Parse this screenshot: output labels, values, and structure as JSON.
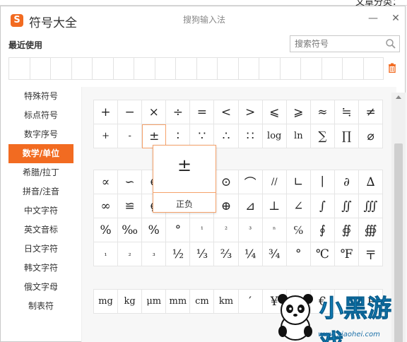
{
  "background": {
    "corner_text": "文章分类："
  },
  "titlebar": {
    "logo_glyph": "S",
    "app_title": "符号大全",
    "ime_title": "搜狗输入法",
    "minimize_glyph": "—",
    "close_glyph": "✕"
  },
  "recent": {
    "label": "最近使用",
    "cells": 18
  },
  "search": {
    "placeholder": "搜索符号"
  },
  "sidebar": {
    "items": [
      {
        "label": "特殊符号"
      },
      {
        "label": "标点符号"
      },
      {
        "label": "数字序号"
      },
      {
        "label": "数学/单位",
        "active": true
      },
      {
        "label": "希腊/拉丁"
      },
      {
        "label": "拼音/注音"
      },
      {
        "label": "中文字符"
      },
      {
        "label": "英文音标"
      },
      {
        "label": "日文字符"
      },
      {
        "label": "韩文字符"
      },
      {
        "label": "俄文字母"
      },
      {
        "label": "制表符"
      }
    ]
  },
  "groups": [
    {
      "rows": [
        [
          "+",
          "−",
          "×",
          "÷",
          "=",
          "<",
          ">",
          "⩽",
          "⩾",
          "≈",
          "≒",
          "≠"
        ],
        [
          "+",
          "-",
          "±",
          "∶",
          "∵",
          "∴",
          "∷",
          "log",
          "ln",
          "∑",
          "∏",
          "⌀"
        ]
      ]
    },
    {
      "rows": [
        [
          "∝",
          "∽",
          "∈",
          "",
          "",
          "⊙",
          "⌒",
          "//",
          "∟",
          "∣",
          "∂",
          "∆"
        ],
        [
          "∞",
          "≌",
          "∉",
          "",
          "",
          "⊕",
          "⊿",
          "⊥",
          "∠",
          "∫",
          "∬",
          "∭"
        ],
        [
          "%",
          "‰",
          "%",
          "°",
          "¹",
          "²",
          "³",
          "ⁿ",
          "℅",
          "∮",
          "∯",
          "∰"
        ],
        [
          "₁",
          "₂",
          "₃",
          "½",
          "⅓",
          "⅔",
          "¼",
          "¾",
          "°",
          "℃",
          "℉",
          "〒"
        ]
      ]
    },
    {
      "rows": [
        [
          "mg",
          "kg",
          "μm",
          "mm",
          "cm",
          "km",
          "′",
          "¥",
          "",
          "€",
          "",
          "₣"
        ]
      ]
    }
  ],
  "popup": {
    "symbol": "±",
    "name": "正负"
  },
  "watermark": {
    "text": "小黑游戏",
    "url": "www.xiaohei.com"
  },
  "colors": {
    "accent": "#f26b21",
    "cell_border": "#e5e5e5",
    "popup_border": "#f5a26b"
  }
}
